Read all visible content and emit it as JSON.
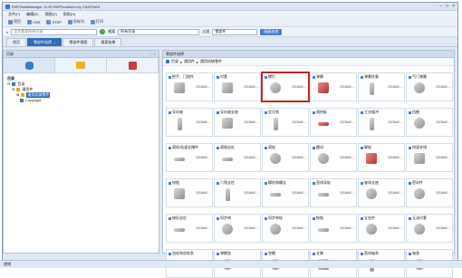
{
  "window": {
    "title": "PARTdataManager 11.00   PARTsolutions by CADENAS"
  },
  "menu": [
    "文件(F)",
    "编辑(E)",
    "视图(V)",
    "帮助(H)"
  ],
  "toolbar": {
    "items": [
      "项目",
      "CNS",
      "STEP",
      "另存为",
      "打印"
    ]
  },
  "searchbar": {
    "search_placeholder": "全文搜索所有目录",
    "search_label": "搜索",
    "catalog_combo": "所有目录",
    "filter_label": "过滤",
    "filter_combo": "零部件",
    "options_button": "高级选项"
  },
  "tabs": [
    {
      "label": "首页",
      "active": false
    },
    {
      "label": "零部件选择",
      "active": true
    },
    {
      "label": "零部件视图",
      "active": false
    },
    {
      "label": "搜索结果",
      "active": false
    }
  ],
  "left_panel": {
    "title": "目录",
    "tree_header": "目录",
    "tree": [
      {
        "label": "目录",
        "level": 0
      },
      {
        "label": "通用件",
        "level": 1
      },
      {
        "label": "通用机械零件",
        "level": 2,
        "selected": true
      },
      {
        "label": "Copyright",
        "level": 2
      }
    ]
  },
  "right_panel": {
    "title": "零部件选择",
    "breadcrumb": [
      "目录",
      "通用件",
      "通用机械零件"
    ]
  },
  "parts": [
    {
      "name": "把手、门锁件",
      "date": "2016/6..."
    },
    {
      "name": "衬套",
      "date": "2016/6..."
    },
    {
      "name": "螺钉",
      "date": "2016/6...",
      "highlight": true
    },
    {
      "name": "弹簧",
      "date": "2016/6..."
    },
    {
      "name": "弹簧柱塞",
      "date": "2016/6..."
    },
    {
      "name": "气门弹簧",
      "date": "2016/6..."
    },
    {
      "name": "导向轴",
      "date": "2016/6..."
    },
    {
      "name": "导向轴支座",
      "date": "2016/6..."
    },
    {
      "name": "定位销",
      "date": "2016/6..."
    },
    {
      "name": "隔热板",
      "date": "2016/6..."
    },
    {
      "name": "工业缓冲",
      "date": "2016/6..."
    },
    {
      "name": "挡圈",
      "date": "2016/6..."
    },
    {
      "name": "滚轮/轨道支撑件",
      "date": "2016/6..."
    },
    {
      "name": "滚珠丝杠",
      "date": "2016/6..."
    },
    {
      "name": "滚轮",
      "date": "2016/6..."
    },
    {
      "name": "螺母",
      "date": "2016/6..."
    },
    {
      "name": "脚轮",
      "date": "2016/6..."
    },
    {
      "name": "快速夹钳",
      "date": "2016/6..."
    },
    {
      "name": "铰链",
      "date": "2016/6..."
    },
    {
      "name": "六角支柱",
      "date": "2016/6..."
    },
    {
      "name": "螺栓和螺丝",
      "date": "2016/6..."
    },
    {
      "name": "直线导轨",
      "date": "2016/6..."
    },
    {
      "name": "轴承支座",
      "date": "2016/6..."
    },
    {
      "name": "密封件",
      "date": "2016/6..."
    },
    {
      "name": "梯形丝杠",
      "date": "2016/6..."
    },
    {
      "name": "同步带",
      "date": "2016/6..."
    },
    {
      "name": "同步带轮",
      "date": "2016/6..."
    },
    {
      "name": "拖链",
      "date": "2016/6..."
    },
    {
      "name": "五金件",
      "date": "2016/6..."
    },
    {
      "name": "无油衬套",
      "date": "2016/6..."
    },
    {
      "name": "齿轮和齿轮条",
      "date": "2016/6..."
    },
    {
      "name": "弹簧垫",
      "date": "2016/6..."
    },
    {
      "name": "垫圈",
      "date": "2016/6..."
    },
    {
      "name": "支脚",
      "date": "2016/6..."
    },
    {
      "name": "直线轴承",
      "date": "2016/6..."
    },
    {
      "name": "轴承",
      "date": "2016/6..."
    }
  ],
  "status": {
    "text": "就绪"
  }
}
